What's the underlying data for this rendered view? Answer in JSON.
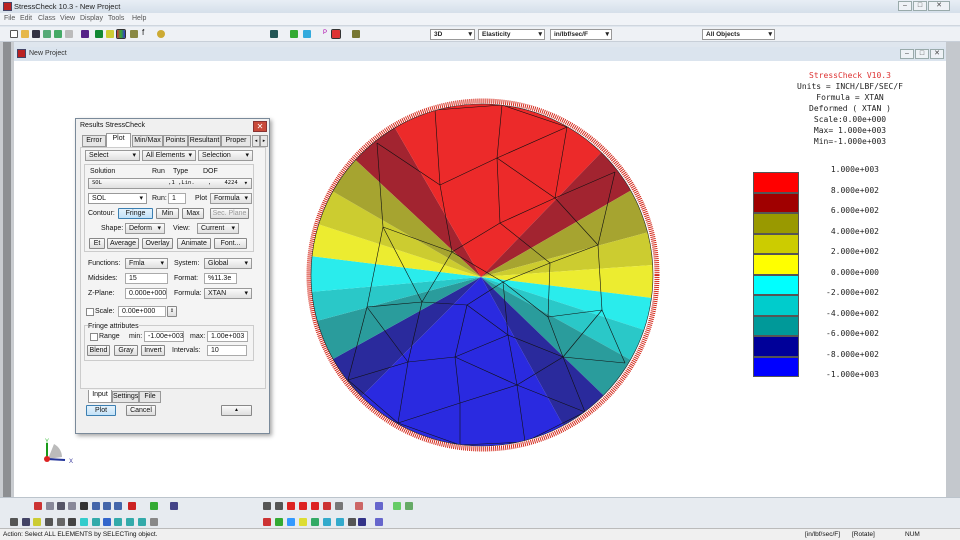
{
  "app": {
    "title": "StressCheck 10.3 - New Project",
    "menu": [
      "File",
      "Edit",
      "Class",
      "View",
      "Display",
      "Tools",
      "Help"
    ]
  },
  "toolbar": {
    "view_mode": "3D",
    "analysis": "Elasticity",
    "units": "in/lbf/sec/F",
    "objects": "All Objects",
    "p_label": "P"
  },
  "mdi": {
    "title": "New Project"
  },
  "viewport": {
    "info": {
      "version": "StressCheck V10.3",
      "units": "Units = INCH/LBF/SEC/F",
      "formula": "Formula = XTAN",
      "deformed": "Deformed ( XTAN )",
      "scale": "Scale:0.00e+000",
      "max": "Max= 1.000e+003",
      "min": "Min=-1.000e+003"
    },
    "legend": {
      "colors": [
        "#ff0000",
        "#a00000",
        "#999900",
        "#cccc00",
        "#ffff00",
        "#00ffff",
        "#00cccc",
        "#009999",
        "#000099",
        "#0000ff"
      ],
      "labels": [
        "1.000e+003",
        "8.000e+002",
        "6.000e+002",
        "4.000e+002",
        "2.000e+002",
        "0.000e+000",
        "-2.000e+002",
        "-4.000e+002",
        "-6.000e+002",
        "-8.000e+002",
        "-1.000e+003"
      ]
    },
    "axes": {
      "x": "X",
      "y": "Y"
    }
  },
  "dialog": {
    "title": "Results StressCheck",
    "tabs": [
      "Error",
      "Plot",
      "Min/Max",
      "Points",
      "Resultant",
      "Proper"
    ],
    "select1": "Select",
    "select2": "All Elements",
    "select3": "Selection",
    "sol_headers": {
      "solution": "Solution",
      "run": "Run",
      "type": "Type",
      "dof": "DOF"
    },
    "sol_row": "SOL                    ,1 ,Lin.    ,    4224",
    "sol_select": "SOL",
    "run_label": "Run:",
    "run_value": "1",
    "plot_label": "Plot",
    "plot_select": "Formula",
    "contour_label": "Contour:",
    "fringe": "Fringe",
    "min": "Min",
    "max": "Max",
    "sec_plane": "Sec. Plane",
    "shape_label": "Shape:",
    "shape_value": "Deform",
    "view_label": "View:",
    "view_value": "Current",
    "et": "Et",
    "average": "Average",
    "overlay": "Overlay",
    "animate": "Animate",
    "font": "Font...",
    "functions_label": "Functions:",
    "functions_value": "Fmla",
    "system_label": "System:",
    "system_value": "Global",
    "midsides_label": "Midsides:",
    "midsides_value": "15",
    "format_label": "Format:",
    "format_value": "%11.3e",
    "zplane_label": "Z-Plane:",
    "zplane_value": "0.000e+000",
    "formula_label": "Formula:",
    "formula_value": "XTAN",
    "scale_label": "Scale:",
    "scale_value": "0.00e+000",
    "fringe_attr": "Fringe attributes",
    "range_label": "Range",
    "min_label": "min:",
    "min_value": "-1.00e+003",
    "max_label": "max:",
    "max_value": "1.00e+003",
    "blend": "Blend",
    "gray": "Gray",
    "invert": "Invert",
    "intervals_label": "Intervals:",
    "intervals_value": "10",
    "bottom_tabs": [
      "Input",
      "Settings",
      "File"
    ],
    "plot_btn": "Plot",
    "cancel_btn": "Cancel",
    "up_btn": "▲"
  },
  "status": {
    "action": "Action:  Select  ALL ELEMENTS  by SELECTing object.",
    "units": "[in/lbf/sec/F]",
    "mode": "[Rotate]",
    "num": "NUM"
  }
}
